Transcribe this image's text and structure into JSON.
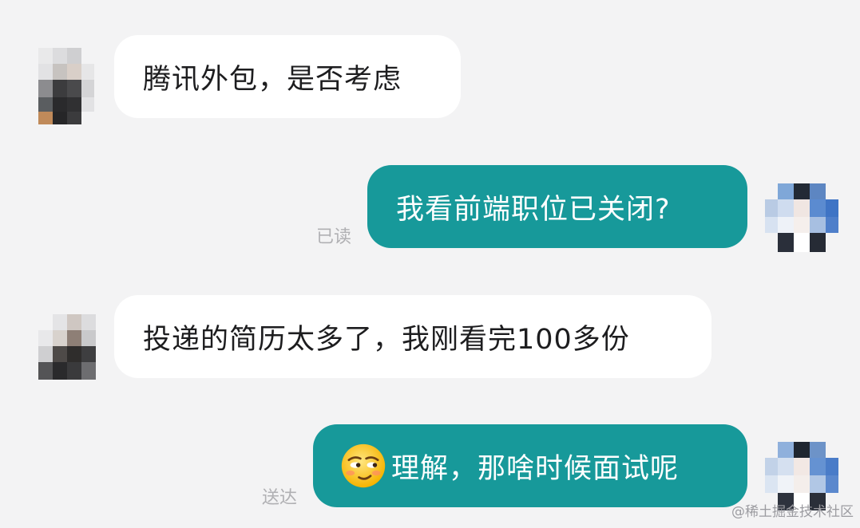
{
  "messages": [
    {
      "side": "incoming",
      "text": "腾讯外包，是否考虑"
    },
    {
      "side": "outgoing",
      "text": "我看前端职位已关闭?",
      "status": "已读"
    },
    {
      "side": "incoming",
      "text": "投递的简历太多了，我刚看完100多份"
    },
    {
      "side": "outgoing",
      "emoji": "smirk-emoji",
      "text": "理解，那啥时候面试呢",
      "status": "送达"
    }
  ],
  "watermark": "@稀土掘金技术社区",
  "colors": {
    "background": "#f3f3f4",
    "incoming_bubble": "#ffffff",
    "outgoing_bubble": "#17999a",
    "status_text": "#b0b0b3"
  }
}
